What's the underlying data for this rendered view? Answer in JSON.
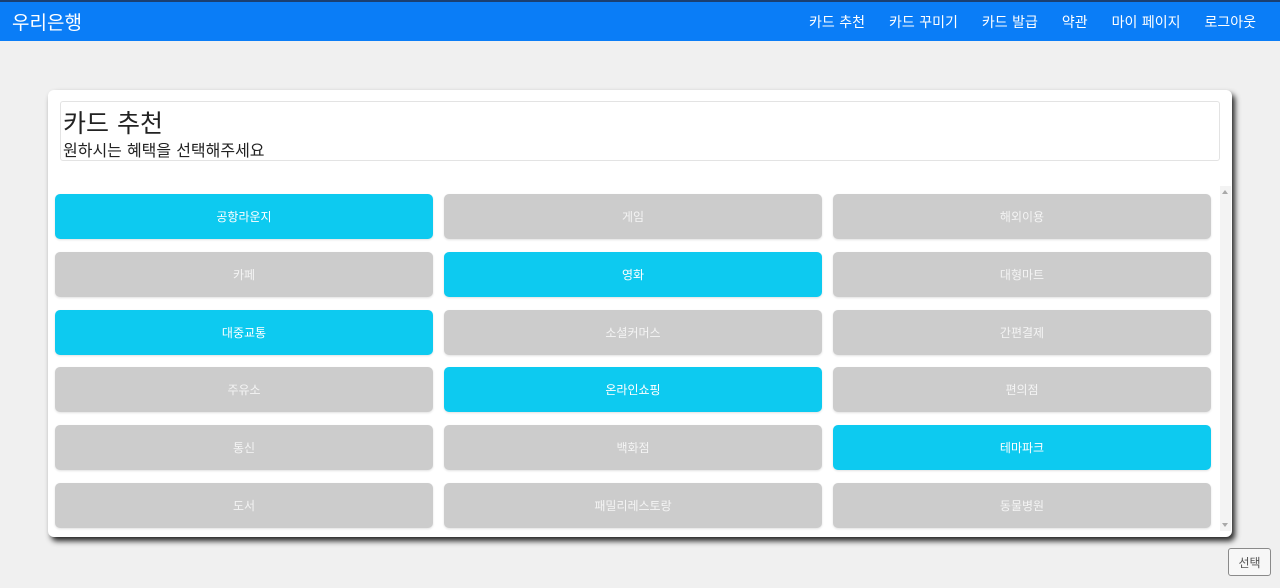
{
  "navbar": {
    "brand": "우리은행",
    "links": [
      "카드 추천",
      "카드 꾸미기",
      "카드 발급",
      "약관",
      "마이 페이지",
      "로그아웃"
    ],
    "background_color": "#0a7df7"
  },
  "header": {
    "title": "카드 추천",
    "subtitle": "원하시는 혜택을 선택해주세요"
  },
  "benefits": [
    {
      "label": "공항라운지",
      "selected": true
    },
    {
      "label": "게임",
      "selected": false
    },
    {
      "label": "해외이용",
      "selected": false
    },
    {
      "label": "카페",
      "selected": false
    },
    {
      "label": "영화",
      "selected": true
    },
    {
      "label": "대형마트",
      "selected": false
    },
    {
      "label": "대중교통",
      "selected": true
    },
    {
      "label": "소셜커머스",
      "selected": false
    },
    {
      "label": "간편결제",
      "selected": false
    },
    {
      "label": "주유소",
      "selected": false
    },
    {
      "label": "온라인쇼핑",
      "selected": true
    },
    {
      "label": "편의점",
      "selected": false
    },
    {
      "label": "통신",
      "selected": false
    },
    {
      "label": "백화점",
      "selected": false
    },
    {
      "label": "테마파크",
      "selected": true
    },
    {
      "label": "도서",
      "selected": false
    },
    {
      "label": "패밀리레스토랑",
      "selected": false
    },
    {
      "label": "동물병원",
      "selected": false
    }
  ],
  "colors": {
    "selected": "#0dcaf0",
    "unselected": "#cccccc"
  },
  "select_button": "선택"
}
